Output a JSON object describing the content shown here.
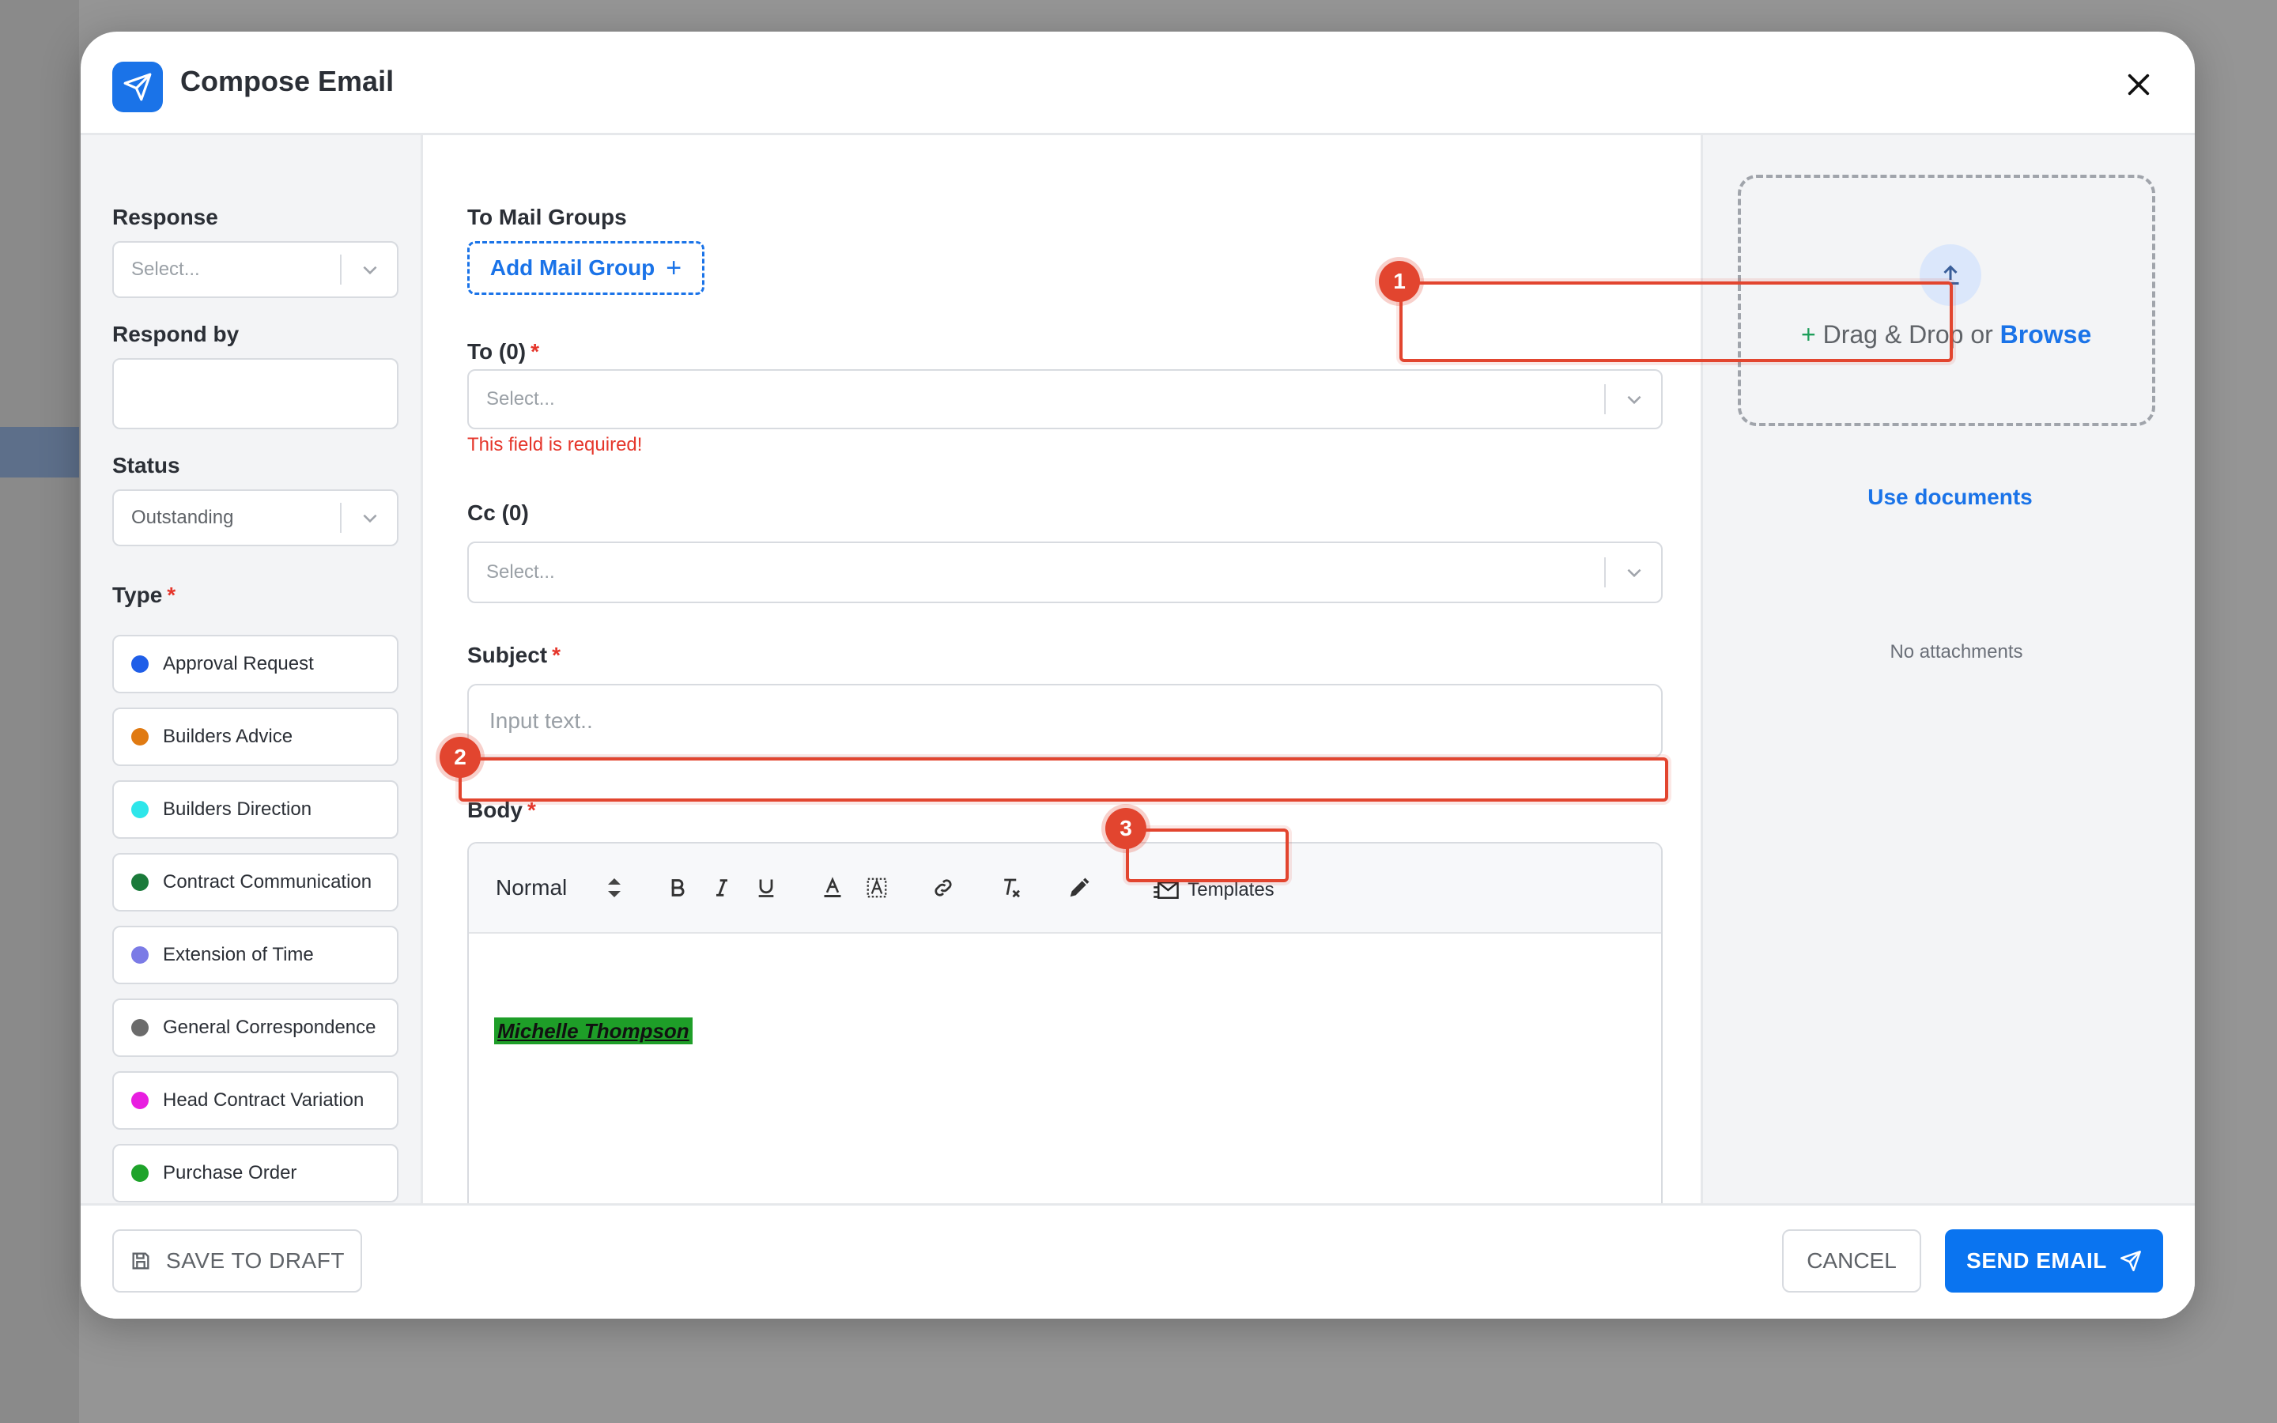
{
  "modal": {
    "title": "Compose Email"
  },
  "left": {
    "response": {
      "label": "Response",
      "placeholder": "Select..."
    },
    "respond_by": {
      "label": "Respond by",
      "value": ""
    },
    "status": {
      "label": "Status",
      "value": "Outstanding"
    },
    "type": {
      "label": "Type",
      "required_mark": "*",
      "items": [
        {
          "label": "Approval Request",
          "color": "#1f5ee8"
        },
        {
          "label": "Builders Advice",
          "color": "#e07a12"
        },
        {
          "label": "Builders Direction",
          "color": "#2ee6ea"
        },
        {
          "label": "Contract Communication",
          "color": "#1a7a3a"
        },
        {
          "label": "Extension of Time",
          "color": "#7b7be6"
        },
        {
          "label": "General Correspondence",
          "color": "#6b6b6b"
        },
        {
          "label": "Head Contract Variation",
          "color": "#e81ee0"
        },
        {
          "label": "Purchase Order",
          "color": "#1ea32a"
        }
      ]
    }
  },
  "middle": {
    "mail_groups": {
      "label": "To Mail Groups",
      "button": "Add Mail Group",
      "plus": "+"
    },
    "to": {
      "label": "To (0)",
      "required_mark": "*",
      "placeholder": "Select...",
      "error": "This field is required!"
    },
    "cc": {
      "label": "Cc (0)",
      "placeholder": "Select..."
    },
    "subject": {
      "label": "Subject",
      "required_mark": "*",
      "placeholder": "Input text.."
    },
    "body": {
      "label": "Body",
      "required_mark": "*",
      "toolbar": {
        "format": "Normal",
        "templates": "Templates"
      },
      "signature": "Michelle Thompson"
    }
  },
  "right": {
    "dropzone": {
      "plus": "+",
      "text_a": " Drag & Drop or ",
      "browse": "Browse"
    },
    "use_documents": "Use documents",
    "no_attachments": "No attachments"
  },
  "footer": {
    "save_draft": "SAVE TO DRAFT",
    "cancel": "CANCEL",
    "send": "SEND EMAIL"
  },
  "annotations": [
    "1",
    "2",
    "3"
  ]
}
